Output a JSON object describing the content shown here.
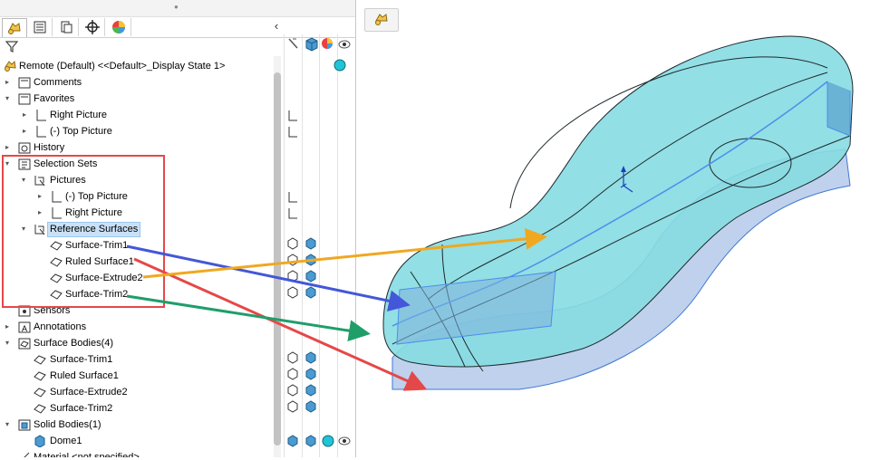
{
  "panel": {
    "tabs": [
      {
        "icon": "feature-manager-icon",
        "active": true
      },
      {
        "icon": "property-manager-icon"
      },
      {
        "icon": "configuration-manager-icon"
      },
      {
        "icon": "dimxpert-icon"
      },
      {
        "icon": "display-manager-icon"
      }
    ],
    "collapse_glyph": "‹",
    "filter_icon": "filter-icon",
    "column_icons": [
      "pin-icon",
      "cube-icon",
      "appearance-icon",
      "eye-icon"
    ]
  },
  "tree": {
    "root": "Remote (Default) <<Default>_Display State 1>",
    "comments": "Comments",
    "favorites": "Favorites",
    "fav_right": "Right Picture",
    "fav_top": "(-) Top Picture",
    "history": "History",
    "selection_sets": "Selection Sets",
    "pictures": "Pictures",
    "pic_top": "(-) Top Picture",
    "pic_right": "Right Picture",
    "reference_surfaces": "Reference Surfaces",
    "ref_trim1": "Surface-Trim1",
    "ref_ruled1": "Ruled Surface1",
    "ref_extrude2": "Surface-Extrude2",
    "ref_trim2": "Surface-Trim2",
    "sensors": "Sensors",
    "annotations": "Annotations",
    "surface_bodies": "Surface Bodies(4)",
    "sb_trim1": "Surface-Trim1",
    "sb_ruled1": "Ruled Surface1",
    "sb_extrude2": "Surface-Extrude2",
    "sb_trim2": "Surface-Trim2",
    "solid_bodies": "Solid Bodies(1)",
    "dome1": "Dome1",
    "material": "Material <not specified>"
  },
  "annotation_colors": {
    "box": "#e54848",
    "trim1_arrow": "#4357d8",
    "ruled_arrow": "#e54848",
    "extrude_arrow": "#f0a820",
    "trim2_arrow": "#1f9e6a"
  }
}
